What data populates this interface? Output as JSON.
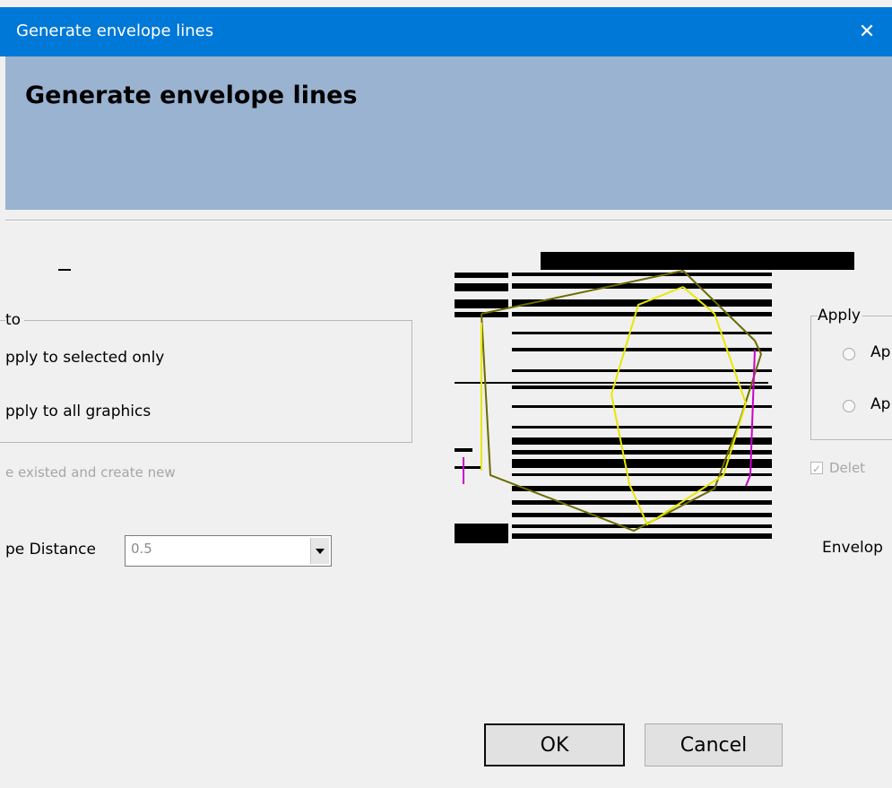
{
  "window": {
    "title": "Generate envelope lines",
    "close_glyph": "✕"
  },
  "header": {
    "heading": "Generate envelope lines"
  },
  "left_panel": {
    "group_title": "to",
    "options": [
      "pply to selected only",
      "pply to all graphics"
    ],
    "checkbox_label": "e existed and create new",
    "distance_label": "pe Distance",
    "distance_value": "0.5"
  },
  "right_panel": {
    "group_title": "Apply",
    "options": [
      "Ap",
      "Ap"
    ],
    "checkbox_label": "Delet",
    "checkbox_checked": true,
    "distance_label": "Envelop"
  },
  "buttons": {
    "ok": "OK",
    "cancel": "Cancel"
  },
  "colors": {
    "titlebar": "#0078d7",
    "banner": "#9ab3d1",
    "dialog_bg": "#f0f0f0"
  }
}
